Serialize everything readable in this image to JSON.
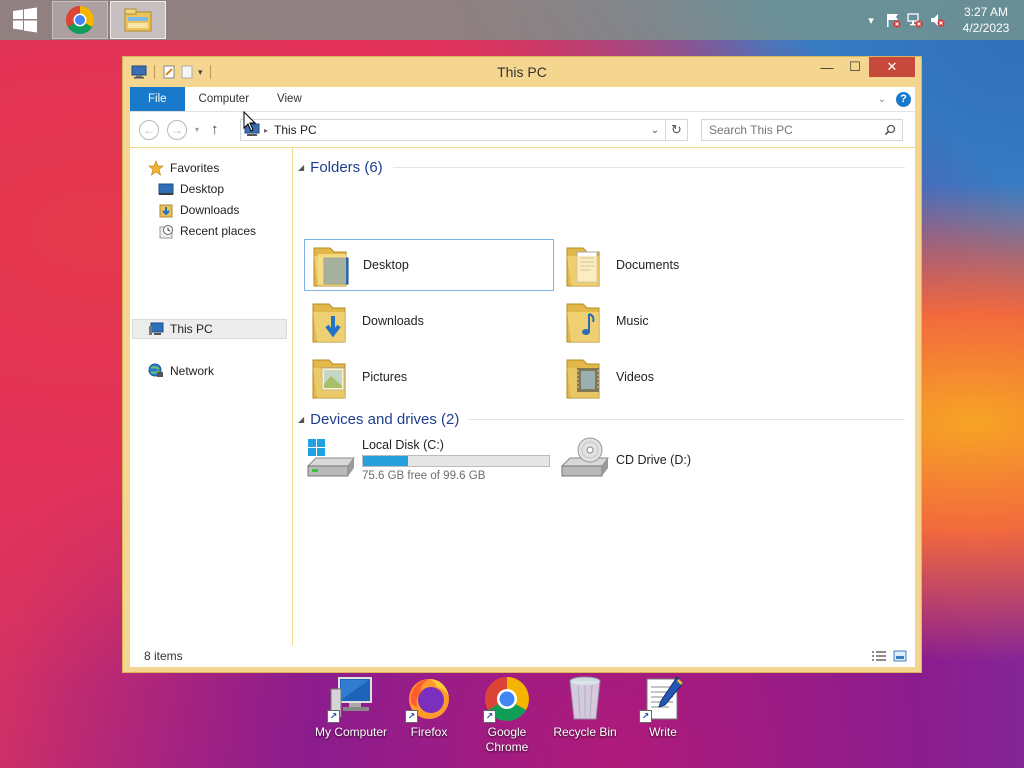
{
  "taskbar": {
    "pinned": [
      {
        "name": "Google Chrome",
        "icon": "chrome-icon"
      },
      {
        "name": "File Explorer",
        "icon": "file-explorer-icon",
        "active": true
      }
    ],
    "clock": {
      "time": "3:27 AM",
      "date": "4/2/2023"
    }
  },
  "window": {
    "title": "This PC",
    "ribbon": {
      "tabs": [
        "File",
        "Computer",
        "View"
      ]
    },
    "address": {
      "crumb": "This PC"
    },
    "search": {
      "placeholder": "Search This PC"
    },
    "nav": {
      "favorites": "Favorites",
      "desktop": "Desktop",
      "downloads": "Downloads",
      "recent": "Recent places",
      "thispc": "This PC",
      "network": "Network"
    },
    "folders": {
      "header": "Folders (6)",
      "items": [
        "Desktop",
        "Documents",
        "Downloads",
        "Music",
        "Pictures",
        "Videos"
      ]
    },
    "devices": {
      "header": "Devices and drives (2)",
      "local": {
        "name": "Local Disk (C:)",
        "free": "75.6 GB free of 99.6 GB",
        "used_fraction": 0.241
      },
      "cd": {
        "name": "CD Drive (D:)"
      }
    },
    "status": "8 items"
  },
  "desktop": {
    "icons": [
      "My Computer",
      "Firefox",
      "Google Chrome",
      "Recycle Bin",
      "Write"
    ]
  },
  "colors": {
    "accent": "#1979ca",
    "window_frame": "#f5d690",
    "close": "#c7493b",
    "drive_fill": "#26a0da"
  }
}
